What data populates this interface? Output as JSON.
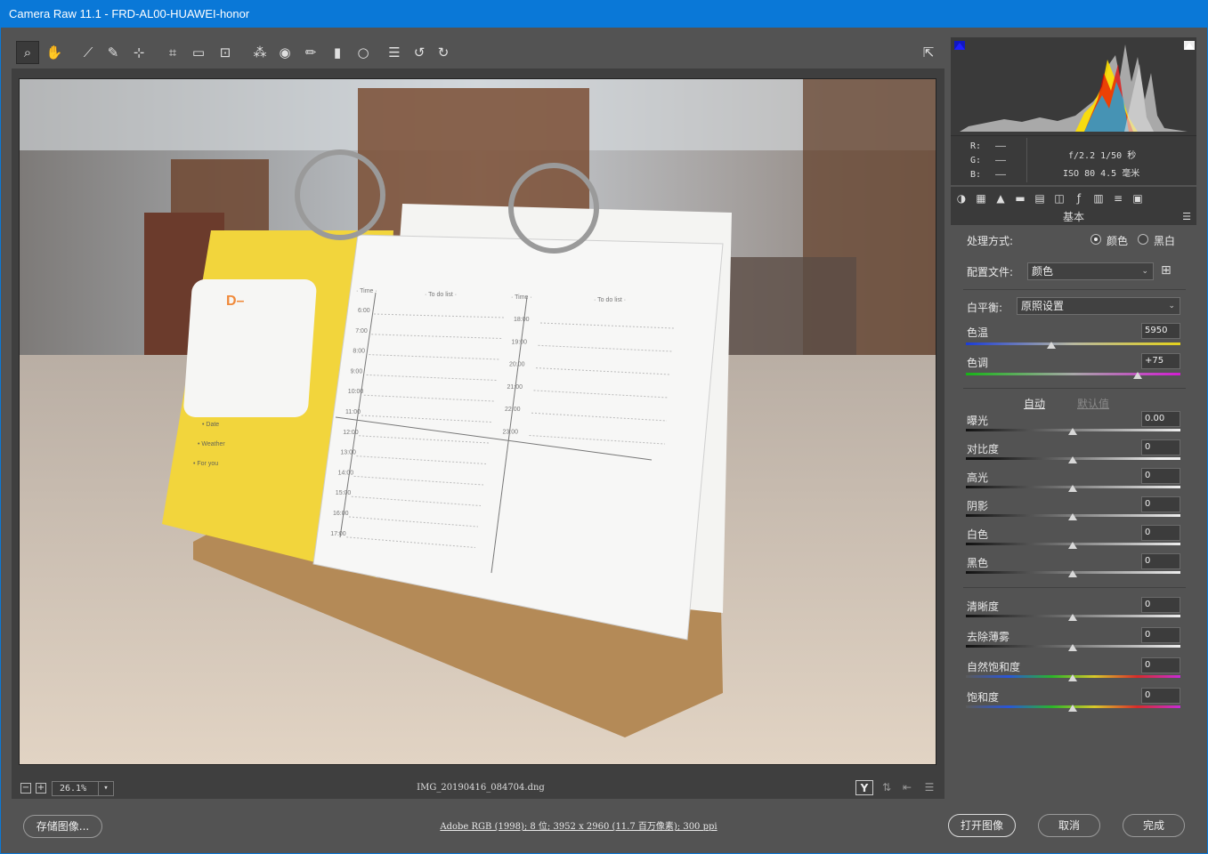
{
  "window": {
    "title": "Camera Raw 11.1 -  FRD-AL00-HUAWEI-honor"
  },
  "toolbar": {
    "tools": [
      {
        "name": "zoom-tool",
        "icon": "magnifier-icon",
        "glyph": "⌕",
        "active": true
      },
      {
        "name": "hand-tool",
        "icon": "hand-icon",
        "glyph": "✋"
      },
      {
        "name": "white-balance-tool",
        "icon": "eyedropper-icon",
        "glyph": "⟋"
      },
      {
        "name": "color-sampler-tool",
        "icon": "color-sampler-icon",
        "glyph": "✎"
      },
      {
        "name": "targeted-adjustment-tool",
        "icon": "target-adjust-icon",
        "glyph": "⊹"
      },
      {
        "name": "crop-tool",
        "icon": "crop-icon",
        "glyph": "⌗"
      },
      {
        "name": "straighten-tool",
        "icon": "straighten-icon",
        "glyph": "▭"
      },
      {
        "name": "transform-tool",
        "icon": "transform-icon",
        "glyph": "⊡"
      },
      {
        "name": "spot-removal-tool",
        "icon": "spot-removal-icon",
        "glyph": "⁂"
      },
      {
        "name": "red-eye-tool",
        "icon": "red-eye-icon",
        "glyph": "◉"
      },
      {
        "name": "adjustment-brush-tool",
        "icon": "brush-icon",
        "glyph": "✏"
      },
      {
        "name": "graduated-filter-tool",
        "icon": "graduated-filter-icon",
        "glyph": "▮"
      },
      {
        "name": "radial-filter-tool",
        "icon": "radial-filter-icon",
        "glyph": "○"
      },
      {
        "name": "preferences-tool",
        "icon": "list-icon",
        "glyph": "☰"
      },
      {
        "name": "rotate-left-tool",
        "icon": "rotate-left-icon",
        "glyph": "↺"
      },
      {
        "name": "rotate-right-tool",
        "icon": "rotate-right-icon",
        "glyph": "↻"
      }
    ],
    "fullscreen_glyph": "⇱"
  },
  "status": {
    "zoom_value": "26.1%",
    "zoom_out": "−",
    "zoom_in": "+",
    "filename": "IMG_20190416_084704.dng",
    "before_after": "Y"
  },
  "meta": {
    "r_label": "R:",
    "g_label": "G:",
    "b_label": "B:",
    "r_value": "——",
    "g_value": "——",
    "b_value": "——",
    "aperture_shutter": "f/2.2  1/50 秒",
    "iso_focal": "ISO 80  4.5 毫米"
  },
  "panel": {
    "title": "基本",
    "treatment_label": "处理方式:",
    "treatment_color": "颜色",
    "treatment_bw": "黑白",
    "profile_label": "配置文件:",
    "profile_value": "颜色",
    "wb_label": "白平衡:",
    "wb_value": "原照设置",
    "temp_label": "色温",
    "temp_value": "5950",
    "tint_label": "色调",
    "tint_value": "+75",
    "auto_label": "自动",
    "default_label": "默认值",
    "sliders": [
      {
        "label": "曝光",
        "value": "0.00"
      },
      {
        "label": "对比度",
        "value": "0"
      },
      {
        "label": "高光",
        "value": "0"
      },
      {
        "label": "阴影",
        "value": "0"
      },
      {
        "label": "白色",
        "value": "0"
      },
      {
        "label": "黑色",
        "value": "0"
      }
    ],
    "presence": [
      {
        "label": "清晰度",
        "value": "0"
      },
      {
        "label": "去除薄雾",
        "value": "0"
      },
      {
        "label": "自然饱和度",
        "value": "0"
      },
      {
        "label": "饱和度",
        "value": "0"
      }
    ],
    "temp_level_fraction": 0.4,
    "tint_level_fraction": 0.8
  },
  "bottom": {
    "save_label": "存储图像...",
    "workflow": "Adobe RGB (1998); 8 位; 3952 x 2960 (11.7 百万像素); 300 ppi",
    "open_label": "打开图像",
    "cancel_label": "取消",
    "done_label": "完成"
  },
  "photo": {
    "calendar_left_heading": "D–",
    "date_label": "• Date",
    "weather_label": "• Weather",
    "foryou_label": "• For you",
    "time_header": "· Time ·",
    "todo_header": "· To do list ·",
    "times_left": [
      "6:00",
      "7:00",
      "8:00",
      "9:00",
      "10:00",
      "11:00",
      "12:00",
      "13:00",
      "14:00",
      "15:00",
      "16:00",
      "17:00"
    ],
    "times_right": [
      "18:00",
      "19:00",
      "20:00",
      "21:00",
      "22:00",
      "23:00"
    ]
  },
  "colors": {
    "titlebar": "#0a78d7",
    "panel": "#535353",
    "dark": "#3a3a3a"
  }
}
